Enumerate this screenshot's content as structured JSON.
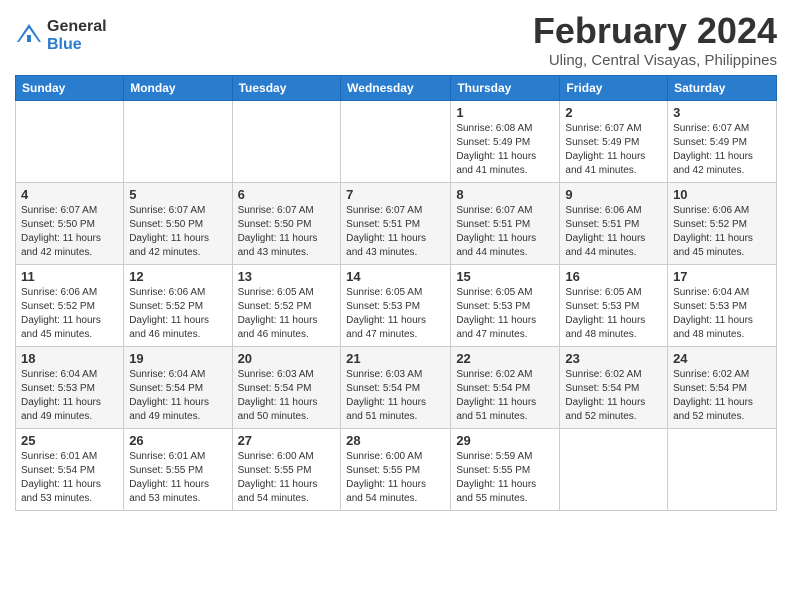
{
  "header": {
    "logo_general": "General",
    "logo_blue": "Blue",
    "month": "February 2024",
    "location": "Uling, Central Visayas, Philippines"
  },
  "days_of_week": [
    "Sunday",
    "Monday",
    "Tuesday",
    "Wednesday",
    "Thursday",
    "Friday",
    "Saturday"
  ],
  "weeks": [
    [
      {
        "day": "",
        "info": ""
      },
      {
        "day": "",
        "info": ""
      },
      {
        "day": "",
        "info": ""
      },
      {
        "day": "",
        "info": ""
      },
      {
        "day": "1",
        "info": "Sunrise: 6:08 AM\nSunset: 5:49 PM\nDaylight: 11 hours\nand 41 minutes."
      },
      {
        "day": "2",
        "info": "Sunrise: 6:07 AM\nSunset: 5:49 PM\nDaylight: 11 hours\nand 41 minutes."
      },
      {
        "day": "3",
        "info": "Sunrise: 6:07 AM\nSunset: 5:49 PM\nDaylight: 11 hours\nand 42 minutes."
      }
    ],
    [
      {
        "day": "4",
        "info": "Sunrise: 6:07 AM\nSunset: 5:50 PM\nDaylight: 11 hours\nand 42 minutes."
      },
      {
        "day": "5",
        "info": "Sunrise: 6:07 AM\nSunset: 5:50 PM\nDaylight: 11 hours\nand 42 minutes."
      },
      {
        "day": "6",
        "info": "Sunrise: 6:07 AM\nSunset: 5:50 PM\nDaylight: 11 hours\nand 43 minutes."
      },
      {
        "day": "7",
        "info": "Sunrise: 6:07 AM\nSunset: 5:51 PM\nDaylight: 11 hours\nand 43 minutes."
      },
      {
        "day": "8",
        "info": "Sunrise: 6:07 AM\nSunset: 5:51 PM\nDaylight: 11 hours\nand 44 minutes."
      },
      {
        "day": "9",
        "info": "Sunrise: 6:06 AM\nSunset: 5:51 PM\nDaylight: 11 hours\nand 44 minutes."
      },
      {
        "day": "10",
        "info": "Sunrise: 6:06 AM\nSunset: 5:52 PM\nDaylight: 11 hours\nand 45 minutes."
      }
    ],
    [
      {
        "day": "11",
        "info": "Sunrise: 6:06 AM\nSunset: 5:52 PM\nDaylight: 11 hours\nand 45 minutes."
      },
      {
        "day": "12",
        "info": "Sunrise: 6:06 AM\nSunset: 5:52 PM\nDaylight: 11 hours\nand 46 minutes."
      },
      {
        "day": "13",
        "info": "Sunrise: 6:05 AM\nSunset: 5:52 PM\nDaylight: 11 hours\nand 46 minutes."
      },
      {
        "day": "14",
        "info": "Sunrise: 6:05 AM\nSunset: 5:53 PM\nDaylight: 11 hours\nand 47 minutes."
      },
      {
        "day": "15",
        "info": "Sunrise: 6:05 AM\nSunset: 5:53 PM\nDaylight: 11 hours\nand 47 minutes."
      },
      {
        "day": "16",
        "info": "Sunrise: 6:05 AM\nSunset: 5:53 PM\nDaylight: 11 hours\nand 48 minutes."
      },
      {
        "day": "17",
        "info": "Sunrise: 6:04 AM\nSunset: 5:53 PM\nDaylight: 11 hours\nand 48 minutes."
      }
    ],
    [
      {
        "day": "18",
        "info": "Sunrise: 6:04 AM\nSunset: 5:53 PM\nDaylight: 11 hours\nand 49 minutes."
      },
      {
        "day": "19",
        "info": "Sunrise: 6:04 AM\nSunset: 5:54 PM\nDaylight: 11 hours\nand 49 minutes."
      },
      {
        "day": "20",
        "info": "Sunrise: 6:03 AM\nSunset: 5:54 PM\nDaylight: 11 hours\nand 50 minutes."
      },
      {
        "day": "21",
        "info": "Sunrise: 6:03 AM\nSunset: 5:54 PM\nDaylight: 11 hours\nand 51 minutes."
      },
      {
        "day": "22",
        "info": "Sunrise: 6:02 AM\nSunset: 5:54 PM\nDaylight: 11 hours\nand 51 minutes."
      },
      {
        "day": "23",
        "info": "Sunrise: 6:02 AM\nSunset: 5:54 PM\nDaylight: 11 hours\nand 52 minutes."
      },
      {
        "day": "24",
        "info": "Sunrise: 6:02 AM\nSunset: 5:54 PM\nDaylight: 11 hours\nand 52 minutes."
      }
    ],
    [
      {
        "day": "25",
        "info": "Sunrise: 6:01 AM\nSunset: 5:54 PM\nDaylight: 11 hours\nand 53 minutes."
      },
      {
        "day": "26",
        "info": "Sunrise: 6:01 AM\nSunset: 5:55 PM\nDaylight: 11 hours\nand 53 minutes."
      },
      {
        "day": "27",
        "info": "Sunrise: 6:00 AM\nSunset: 5:55 PM\nDaylight: 11 hours\nand 54 minutes."
      },
      {
        "day": "28",
        "info": "Sunrise: 6:00 AM\nSunset: 5:55 PM\nDaylight: 11 hours\nand 54 minutes."
      },
      {
        "day": "29",
        "info": "Sunrise: 5:59 AM\nSunset: 5:55 PM\nDaylight: 11 hours\nand 55 minutes."
      },
      {
        "day": "",
        "info": ""
      },
      {
        "day": "",
        "info": ""
      }
    ]
  ]
}
